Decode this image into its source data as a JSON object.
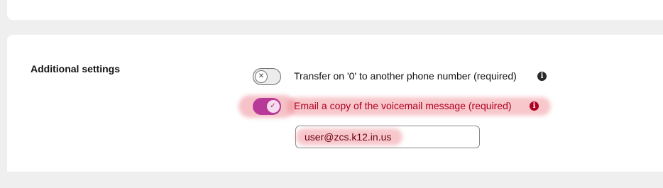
{
  "section": {
    "title": "Additional settings"
  },
  "settings": {
    "transfer": {
      "label": "Transfer on '0' to another phone number (required)",
      "toggle_state": "off",
      "toggle_glyph": "✕",
      "info_icon": "info-icon"
    },
    "email_copy": {
      "label": "Email a copy of the voicemail message (required)",
      "toggle_state": "on",
      "toggle_glyph": "✓",
      "info_icon": "info-icon",
      "email_value": "user@zcs.k12.in.us"
    }
  },
  "colors": {
    "accent": "#b83a98",
    "error": "#b00020",
    "highlight": "#ee828c"
  }
}
